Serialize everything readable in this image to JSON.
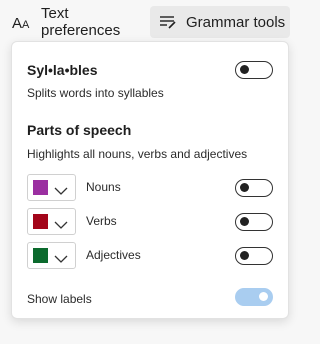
{
  "tabs": {
    "text_preferences": "Text preferences",
    "grammar_tools": "Grammar tools"
  },
  "syllables": {
    "title": "Syl•la•bles",
    "description": "Splits words into syllables",
    "enabled": false
  },
  "parts_of_speech": {
    "title": "Parts of speech",
    "description": "Highlights all nouns, verbs and adjectives",
    "rows": [
      {
        "label": "Nouns",
        "color": "#9b2fa1",
        "enabled": false
      },
      {
        "label": "Verbs",
        "color": "#a3051a",
        "enabled": false
      },
      {
        "label": "Adjectives",
        "color": "#0b6a2d",
        "enabled": false
      }
    ]
  },
  "show_labels": {
    "label": "Show labels",
    "enabled": true
  },
  "colors": {
    "toggle_on": "#a9cdf0",
    "active_tab_bg": "#e9e9e9"
  }
}
